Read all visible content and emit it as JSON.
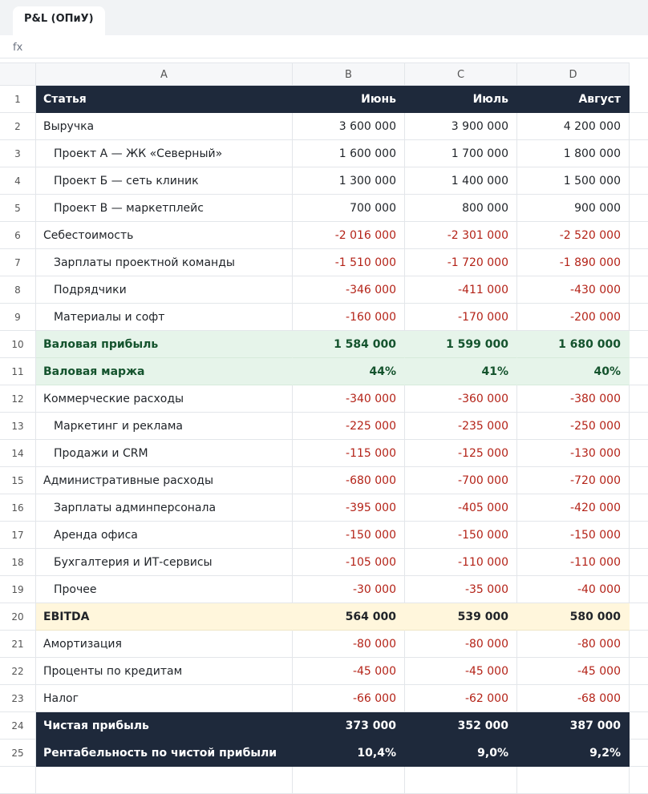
{
  "tab": {
    "label": "P&L (ОПиУ)"
  },
  "formula_bar": {
    "label": "fx"
  },
  "columns": [
    "A",
    "B",
    "C",
    "D"
  ],
  "rows": [
    {
      "n": "1",
      "style": "header",
      "a": "Статья",
      "b": "Июнь",
      "c": "Июль",
      "d": "Август"
    },
    {
      "n": "2",
      "a": "Выручка",
      "b": "3 600 000",
      "c": "3 900 000",
      "d": "4 200 000"
    },
    {
      "n": "3",
      "indent": true,
      "a": "Проект А — ЖК «Северный»",
      "b": "1 600 000",
      "c": "1 700 000",
      "d": "1 800 000"
    },
    {
      "n": "4",
      "indent": true,
      "a": "Проект Б — сеть клиник",
      "b": "1 300 000",
      "c": "1 400 000",
      "d": "1 500 000"
    },
    {
      "n": "5",
      "indent": true,
      "a": "Проект В — маркетплейс",
      "b": "700 000",
      "c": "800 000",
      "d": "900 000"
    },
    {
      "n": "6",
      "a": "Себестоимость",
      "b": "-2 016 000",
      "c": "-2 301 000",
      "d": "-2 520 000"
    },
    {
      "n": "7",
      "indent": true,
      "a": "Зарплаты проектной команды",
      "b": "-1 510 000",
      "c": "-1 720 000",
      "d": "-1 890 000"
    },
    {
      "n": "8",
      "indent": true,
      "a": "Подрядчики",
      "b": "-346 000",
      "c": "-411 000",
      "d": "-430 000"
    },
    {
      "n": "9",
      "indent": true,
      "a": "Материалы и софт",
      "b": "-160 000",
      "c": "-170 000",
      "d": "-200 000"
    },
    {
      "n": "10",
      "style": "green",
      "a": "Валовая прибыль",
      "b": "1 584 000",
      "c": "1 599 000",
      "d": "1 680 000"
    },
    {
      "n": "11",
      "style": "green",
      "a": "Валовая маржа",
      "b": "44%",
      "c": "41%",
      "d": "40%"
    },
    {
      "n": "12",
      "a": "Коммерческие расходы",
      "b": "-340 000",
      "c": "-360 000",
      "d": "-380 000"
    },
    {
      "n": "13",
      "indent": true,
      "a": "Маркетинг и реклама",
      "b": "-225 000",
      "c": "-235 000",
      "d": "-250 000"
    },
    {
      "n": "14",
      "indent": true,
      "a": "Продажи и CRM",
      "b": "-115 000",
      "c": "-125 000",
      "d": "-130 000"
    },
    {
      "n": "15",
      "a": "Административные расходы",
      "b": "-680 000",
      "c": "-700 000",
      "d": "-720 000"
    },
    {
      "n": "16",
      "indent": true,
      "a": "Зарплаты админперсонала",
      "b": "-395 000",
      "c": "-405 000",
      "d": "-420 000"
    },
    {
      "n": "17",
      "indent": true,
      "a": "Аренда офиса",
      "b": "-150 000",
      "c": "-150 000",
      "d": "-150 000"
    },
    {
      "n": "18",
      "indent": true,
      "a": "Бухгалтерия и ИТ-сервисы",
      "b": "-105 000",
      "c": "-110 000",
      "d": "-110 000"
    },
    {
      "n": "19",
      "indent": true,
      "a": "Прочее",
      "b": "-30 000",
      "c": "-35 000",
      "d": "-40 000"
    },
    {
      "n": "20",
      "style": "yellow",
      "a": "EBITDA",
      "b": "564 000",
      "c": "539 000",
      "d": "580 000"
    },
    {
      "n": "21",
      "a": "Амортизация",
      "b": "-80 000",
      "c": "-80 000",
      "d": "-80 000"
    },
    {
      "n": "22",
      "a": "Проценты по кредитам",
      "b": "-45 000",
      "c": "-45 000",
      "d": "-45 000"
    },
    {
      "n": "23",
      "a": "Налог",
      "b": "-66 000",
      "c": "-62 000",
      "d": "-68 000"
    },
    {
      "n": "24",
      "style": "dark",
      "a": "Чистая прибыль",
      "b": "373 000",
      "c": "352 000",
      "d": "387 000"
    },
    {
      "n": "25",
      "style": "dark",
      "a": "Рентабельность по чистой прибыли",
      "b": "10,4%",
      "c": "9,0%",
      "d": "9,2%"
    },
    {
      "n": "",
      "a": "",
      "b": "",
      "c": "",
      "d": ""
    }
  ],
  "colors": {
    "header_bg": "#1e293b",
    "negative": "#b42318",
    "gross_bg": "#e6f4ea",
    "gross_text": "#14532d",
    "ebitda_bg": "#fff6dc"
  }
}
